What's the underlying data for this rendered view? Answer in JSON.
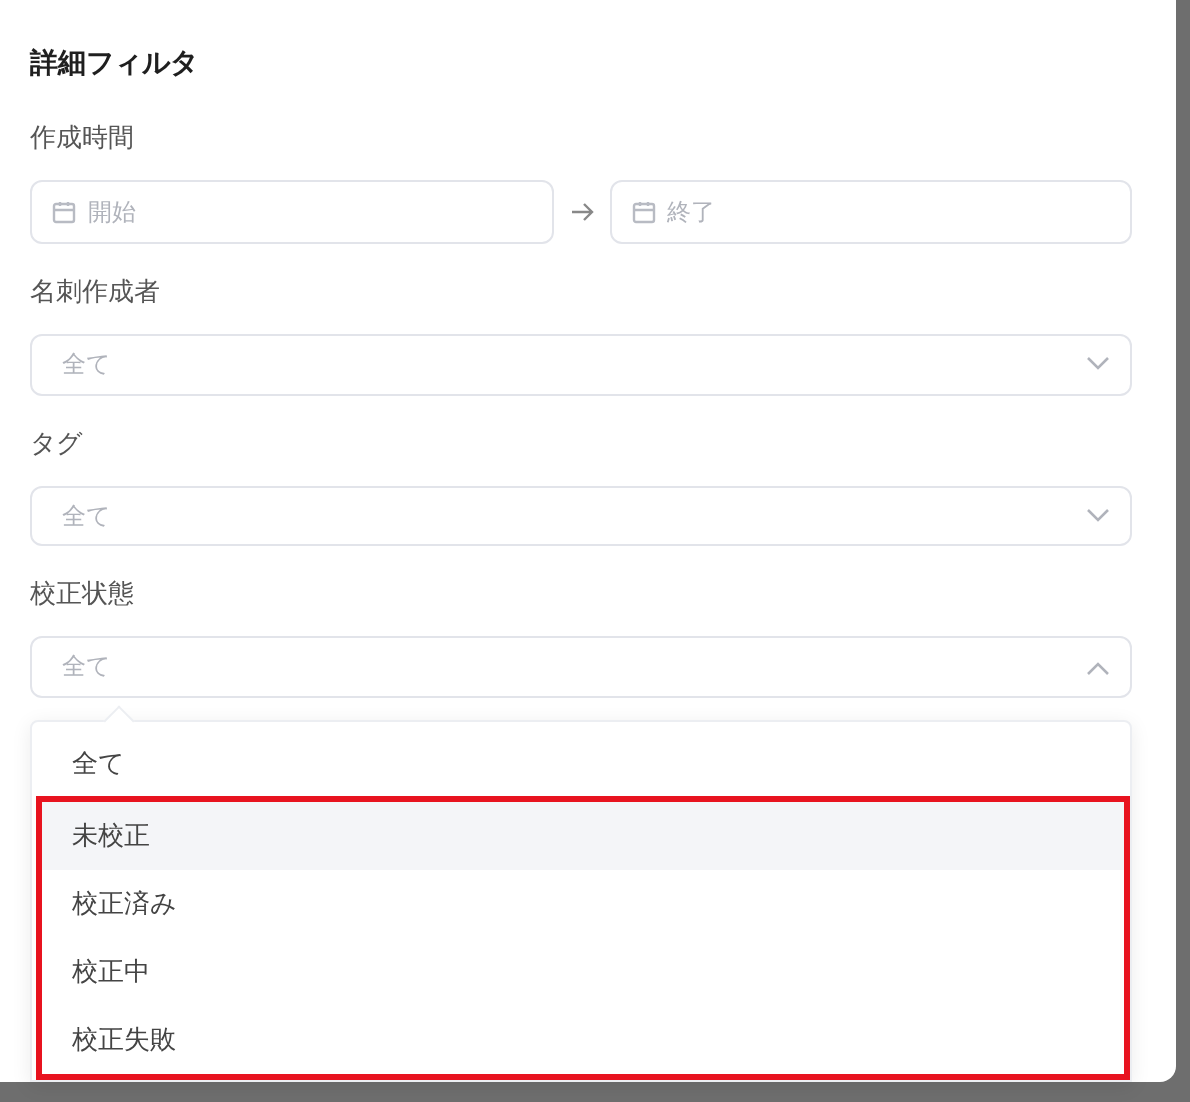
{
  "title": "詳細フィルタ",
  "fields": [
    {
      "kind": "date_range",
      "label": "作成時間",
      "start_placeholder": "開始",
      "end_placeholder": "終了"
    },
    {
      "kind": "select",
      "label": "名刺作成者",
      "placeholder": "全て",
      "open": false
    },
    {
      "kind": "select",
      "label": "タグ",
      "placeholder": "全て",
      "open": false
    },
    {
      "kind": "select",
      "label": "校正状態",
      "placeholder": "全て",
      "open": true,
      "options": [
        {
          "label": "全て",
          "highlighted": false,
          "framed": false
        },
        {
          "label": "未校正",
          "highlighted": true,
          "framed": true
        },
        {
          "label": "校正済み",
          "highlighted": false,
          "framed": true
        },
        {
          "label": "校正中",
          "highlighted": false,
          "framed": true
        },
        {
          "label": "校正失敗",
          "highlighted": false,
          "framed": true
        }
      ]
    }
  ]
}
